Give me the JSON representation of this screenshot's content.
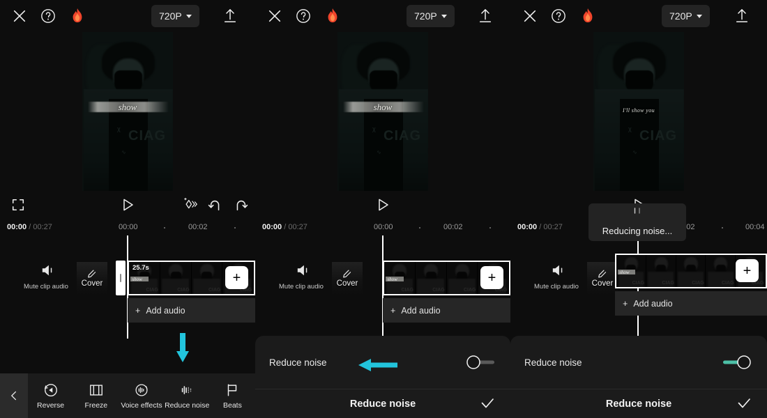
{
  "app": {
    "header": {
      "close_icon": "close-icon",
      "help_icon": "help-icon",
      "flame_icon": "flame-icon",
      "resolution_label": "720P",
      "export_icon": "upload-icon"
    },
    "transport": {
      "fullscreen_icon": "fullscreen-icon",
      "play_icon": "play-icon",
      "magic_icon": "magic-effects-icon",
      "undo_icon": "undo-icon",
      "redo_icon": "redo-icon"
    },
    "timeline": {
      "current_time": "00:00",
      "total_time": "00:27",
      "time_separator": "/",
      "mute_label": "Mute clip audio",
      "mute_icon": "speaker-icon",
      "cover_label": "Cover",
      "cover_pen_icon": "pencil-icon",
      "clip_duration": "25.7s",
      "add_clip_icon": "plus-icon",
      "add_audio_label": "Add audio",
      "add_audio_icon": "plus-icon",
      "ticks_p1": [
        "00:00",
        "00:02"
      ],
      "ticks_p2": [
        "00:00",
        "00:02"
      ],
      "ticks_p3": [
        "00:00",
        "00:02",
        "00:04"
      ]
    },
    "toolbar": {
      "back_icon": "chevron-left-icon",
      "items": [
        {
          "label": "Reverse",
          "icon": "reverse-icon"
        },
        {
          "label": "Freeze",
          "icon": "freeze-icon"
        },
        {
          "label": "Voice effects",
          "icon": "voice-effects-icon"
        },
        {
          "label": "Reduce noise",
          "icon": "reduce-noise-icon"
        },
        {
          "label": "Beats",
          "icon": "beats-flag-icon"
        }
      ]
    },
    "sheet": {
      "row_label": "Reduce noise",
      "title": "Reduce noise",
      "confirm_icon": "check-icon",
      "toggle_off_state": "off",
      "toggle_on_state": "on"
    },
    "toast": {
      "message": "Reducing noise...",
      "spinner_icon": "loading-spinner-icon"
    },
    "preview": {
      "caption_p1": "show",
      "caption_p2": "show",
      "caption_p3": "I'll show you",
      "brand_text": "CIAG"
    },
    "annotations": {
      "down_arrow_icon": "down-arrow-annotation",
      "left_arrow_icon": "left-arrow-annotation",
      "color": "#22C4DC"
    }
  },
  "colors": {
    "accent_toggle_on": "#4CBFA6",
    "annotation_cyan": "#22C4DC",
    "flame_red": "#F0452B",
    "panel_bg": "#0D0D0D",
    "sheet_bg": "#1B1B1B"
  }
}
